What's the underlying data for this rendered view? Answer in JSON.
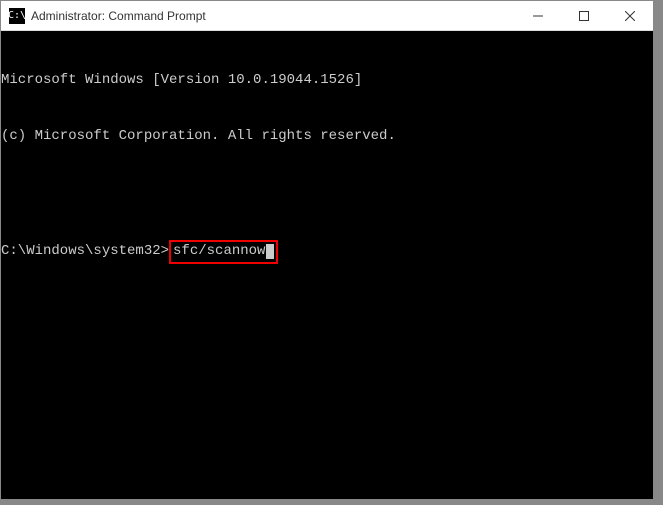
{
  "window": {
    "title": "Administrator: Command Prompt",
    "icon_label": "cmd-icon"
  },
  "controls": {
    "minimize": "Minimize",
    "maximize": "Maximize",
    "close": "Close"
  },
  "terminal": {
    "line1": "Microsoft Windows [Version 10.0.19044.1526]",
    "line2": "(c) Microsoft Corporation. All rights reserved.",
    "prompt": "C:\\Windows\\system32>",
    "command": "sfc/scannow"
  }
}
